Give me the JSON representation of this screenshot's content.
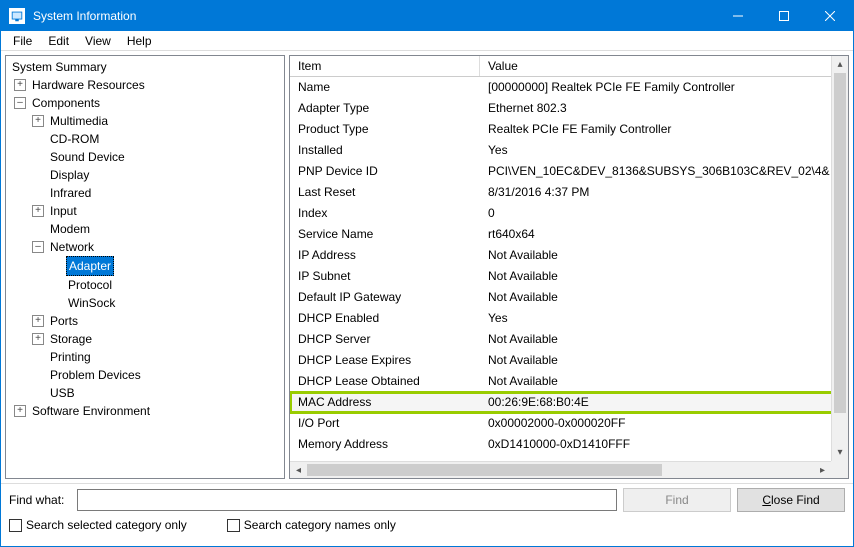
{
  "window": {
    "title": "System Information"
  },
  "menu": {
    "file": "File",
    "edit": "Edit",
    "view": "View",
    "help": "Help"
  },
  "tree": {
    "system_summary": "System Summary",
    "hardware_resources": "Hardware Resources",
    "components": "Components",
    "multimedia": "Multimedia",
    "cdrom": "CD-ROM",
    "sound_device": "Sound Device",
    "display": "Display",
    "infrared": "Infrared",
    "input": "Input",
    "modem": "Modem",
    "network": "Network",
    "adapter": "Adapter",
    "protocol": "Protocol",
    "winsock": "WinSock",
    "ports": "Ports",
    "storage": "Storage",
    "printing": "Printing",
    "problem_devices": "Problem Devices",
    "usb": "USB",
    "software_environment": "Software Environment"
  },
  "columns": {
    "item": "Item",
    "value": "Value"
  },
  "rows": [
    {
      "item": "Name",
      "value": "[00000000] Realtek PCIe FE Family Controller"
    },
    {
      "item": "Adapter Type",
      "value": "Ethernet 802.3"
    },
    {
      "item": "Product Type",
      "value": "Realtek PCIe FE Family Controller"
    },
    {
      "item": "Installed",
      "value": "Yes"
    },
    {
      "item": "PNP Device ID",
      "value": "PCI\\VEN_10EC&DEV_8136&SUBSYS_306B103C&REV_02\\4&"
    },
    {
      "item": "Last Reset",
      "value": "8/31/2016 4:37 PM"
    },
    {
      "item": "Index",
      "value": "0"
    },
    {
      "item": "Service Name",
      "value": "rt640x64"
    },
    {
      "item": "IP Address",
      "value": "Not Available"
    },
    {
      "item": "IP Subnet",
      "value": "Not Available"
    },
    {
      "item": "Default IP Gateway",
      "value": "Not Available"
    },
    {
      "item": "DHCP Enabled",
      "value": "Yes"
    },
    {
      "item": "DHCP Server",
      "value": "Not Available"
    },
    {
      "item": "DHCP Lease Expires",
      "value": "Not Available"
    },
    {
      "item": "DHCP Lease Obtained",
      "value": "Not Available"
    },
    {
      "item": "MAC Address",
      "value": "00:26:9E:68:B0:4E",
      "highlight": true
    },
    {
      "item": "I/O Port",
      "value": "0x00002000-0x000020FF"
    },
    {
      "item": "Memory Address",
      "value": "0xD1410000-0xD1410FFF"
    }
  ],
  "footer": {
    "find_what": "Find what:",
    "find": "Find",
    "close_find": "Close Find",
    "search_selected": "Search selected category only",
    "search_names": "Search category names only"
  }
}
